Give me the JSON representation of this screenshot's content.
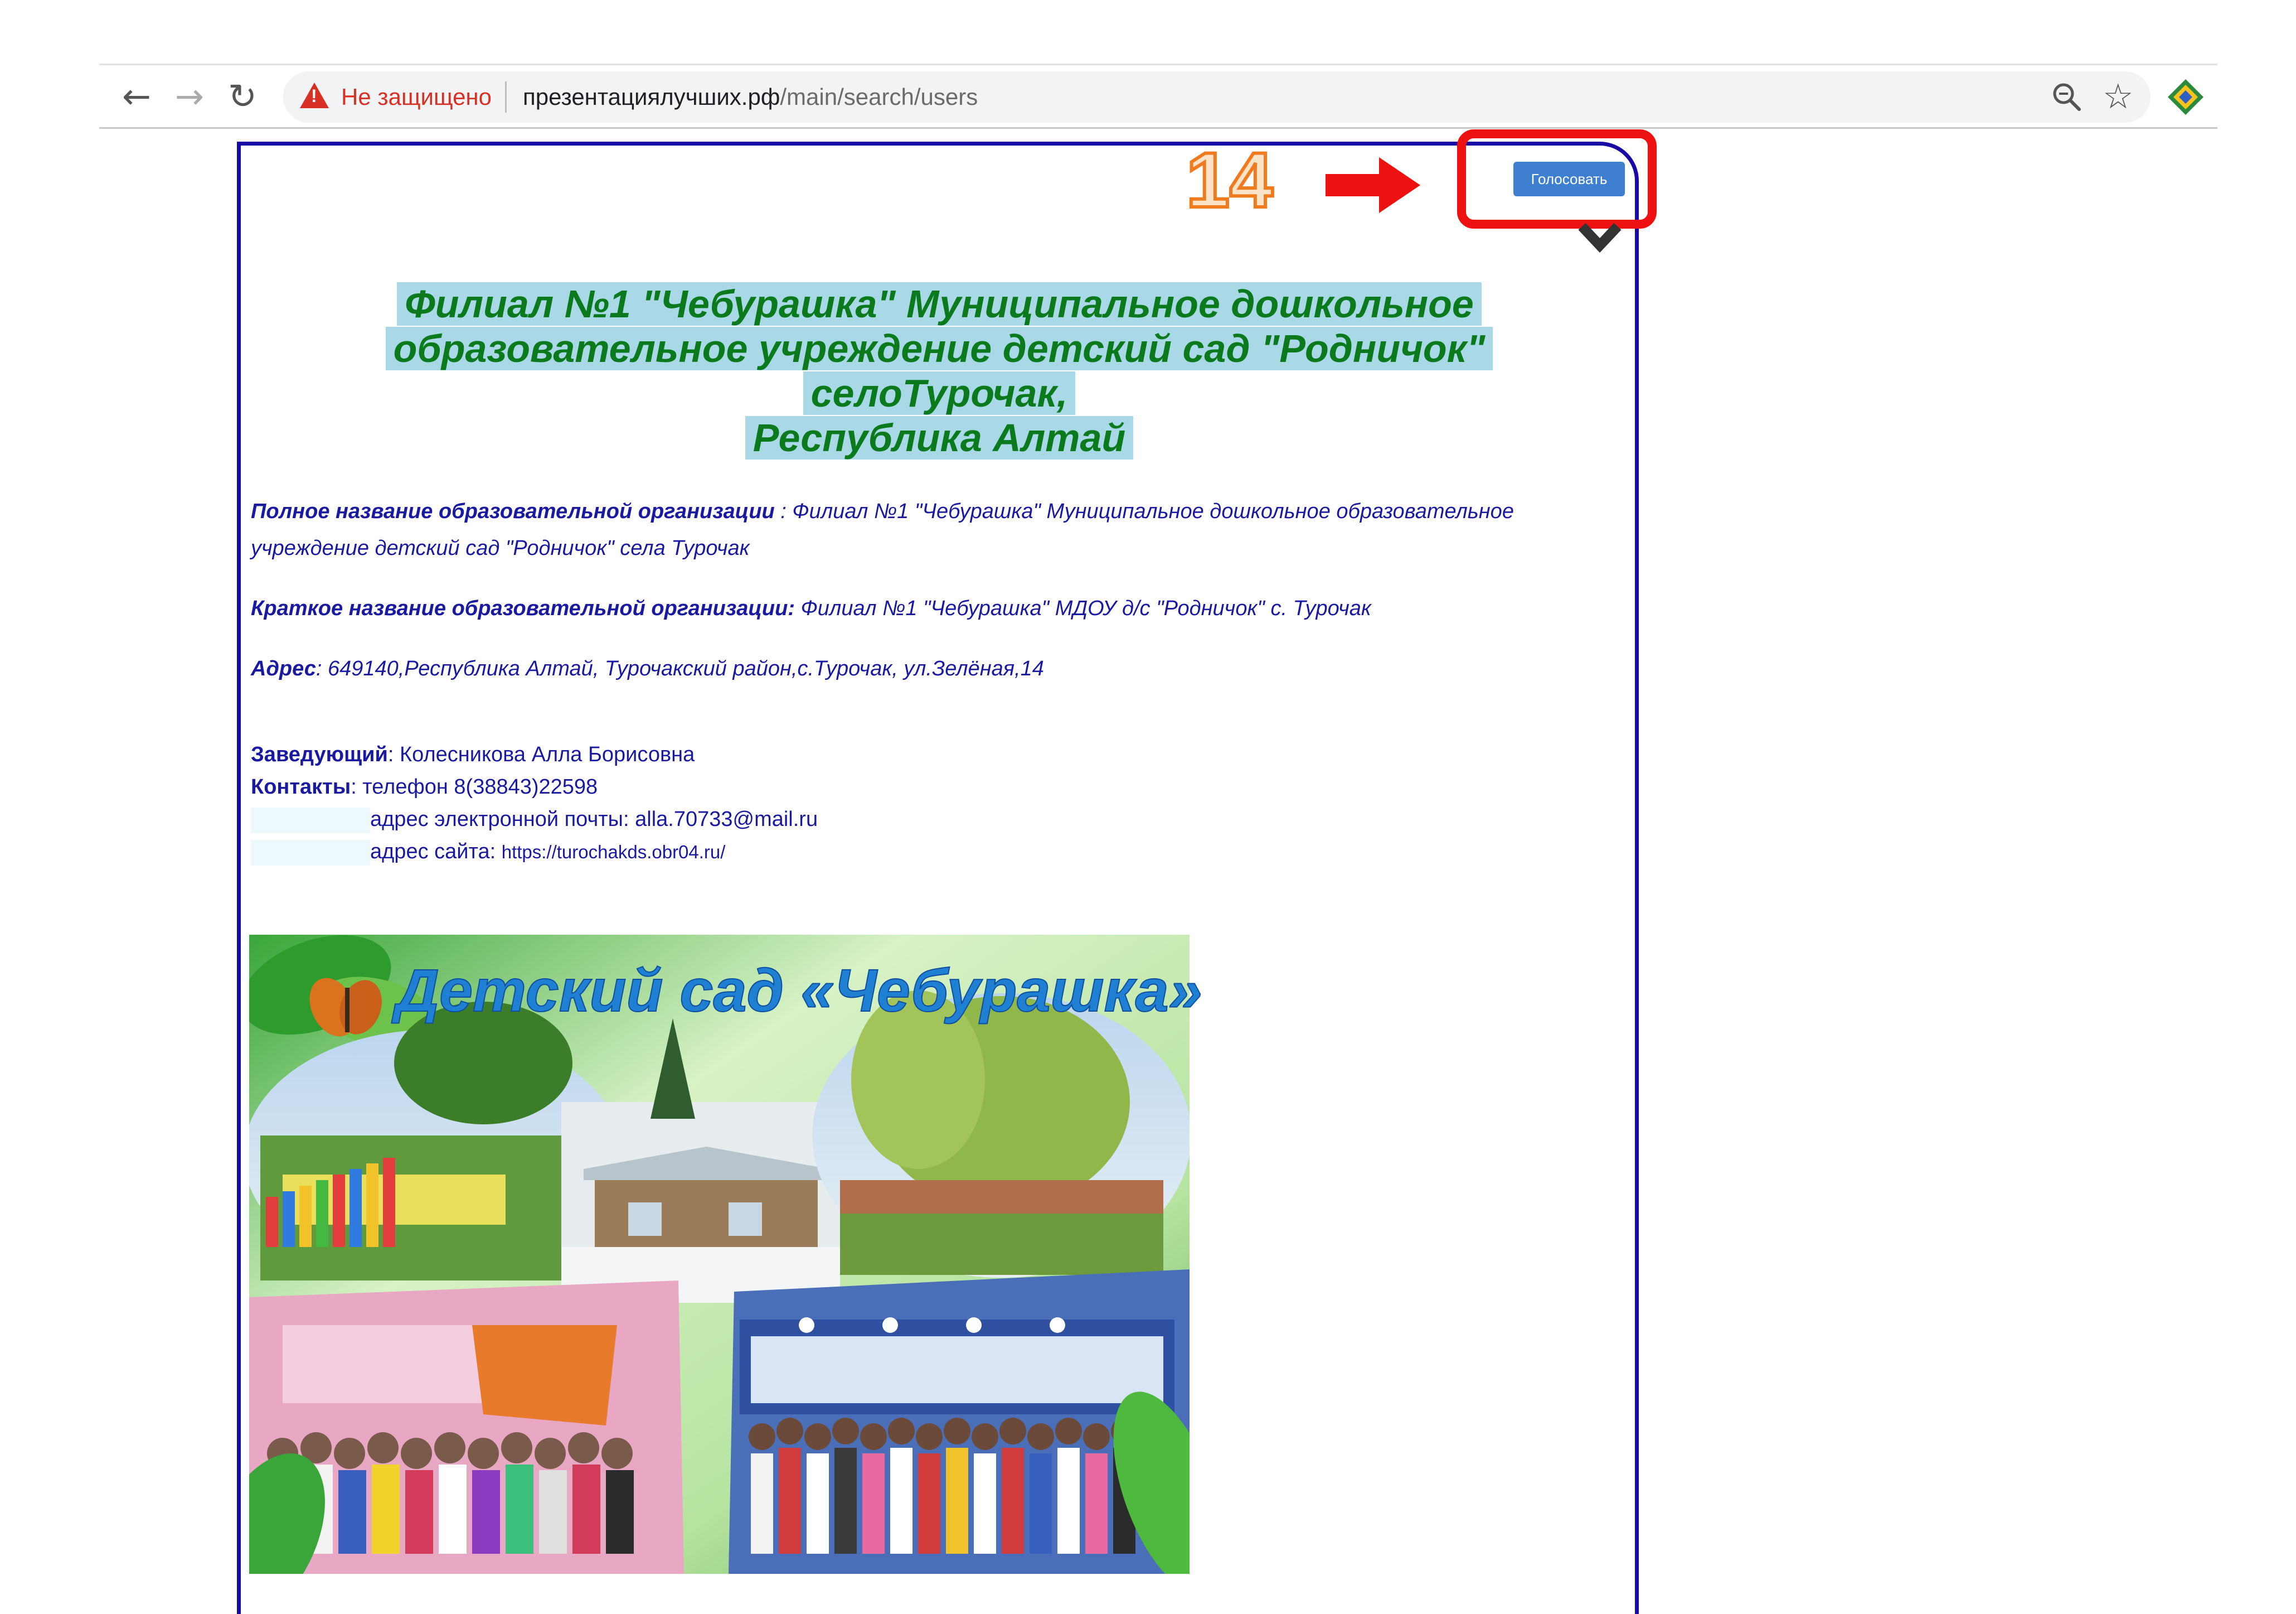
{
  "browser": {
    "back_icon": "arrow-left-icon",
    "forward_icon": "arrow-right-icon",
    "reload_icon": "reload-icon",
    "security_label": "Не защищено",
    "url_host": "презентациялучших.рф",
    "url_path": "/main/search/users",
    "zoom_icon": "zoom-icon",
    "bookmark_icon": "star-icon",
    "extension_icon": "extension-icon"
  },
  "annotation": {
    "step_number": "14",
    "arrow_icon": "red-arrow-icon",
    "highlight_color": "#ee1111"
  },
  "vote": {
    "label": "Голосовать"
  },
  "page": {
    "title_lines": [
      "Филиал №1 \"Чебурашка\" Муниципальное дошкольное",
      "образовательное учреждение детский сад \"Родничок\"",
      "селоТурочак,",
      "Республика Алтай"
    ],
    "full_name_label": "Полное название образовательной организации",
    "full_name_value": " : Филиал №1 \"Чебурашка\" Муниципальное дошкольное образовательное учреждение детский сад \"Родничок\" села Турочак",
    "short_name_label": "Краткое название образовательной организации:",
    "short_name_value": " Филиал №1 \"Чебурашка\" МДОУ д/с \"Родничок\" с. Турочак",
    "address_label": "Адрес",
    "address_value": ": 649140,Республика Алтай, Турочакский район,с.Турочак, ул.Зелёная,14",
    "head_label": "Заведующий",
    "head_value": ": Колесникова Алла Борисовна",
    "contacts_label": "Контакты",
    "contacts_value": ": телефон 8(38843)22598",
    "email_line": "адрес электронной почты: alla.70733@mail.ru",
    "site_prefix": "адрес сайта: ",
    "site_url": "https://turochakds.obr04.ru/",
    "collage_title": "Детский сад «Чебурашка»"
  },
  "colors": {
    "frame": "#1a0aa5",
    "title_green": "#0b7a1d",
    "title_highlight": "#a9d8e6",
    "text_blue": "#1a1aa0",
    "vote_button": "#3f7fcf"
  }
}
